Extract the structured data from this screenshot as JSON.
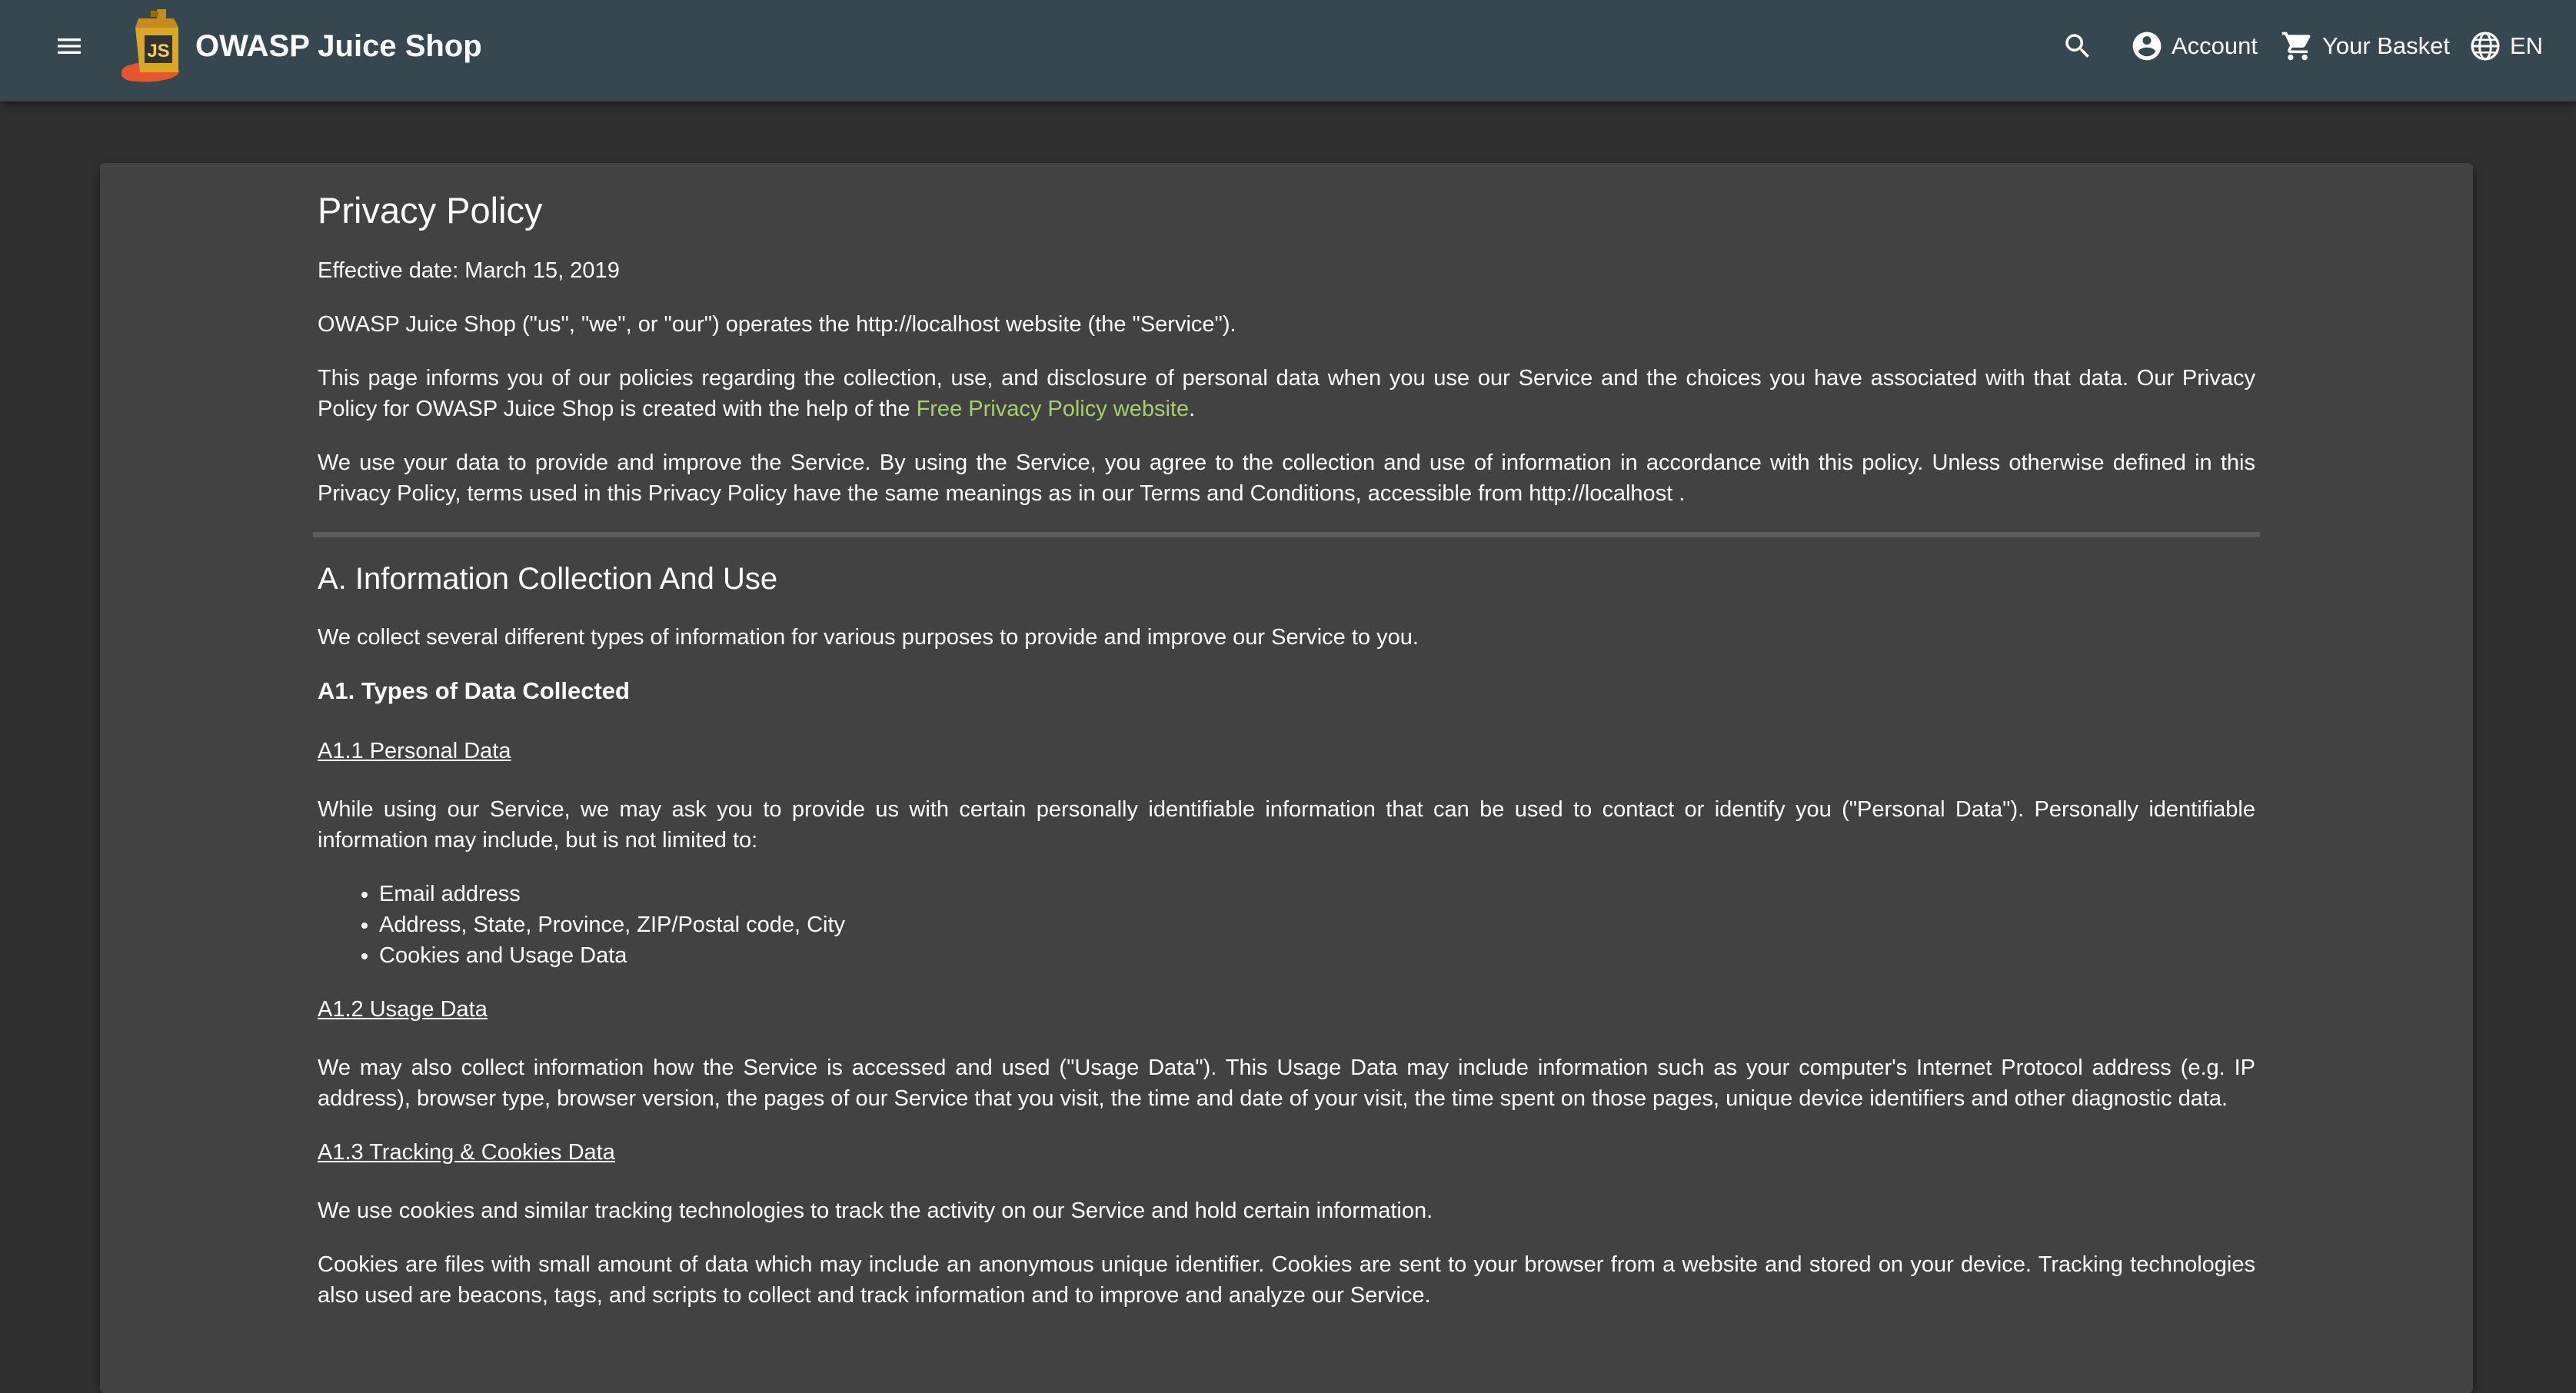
{
  "header": {
    "app_title": "OWASP Juice Shop",
    "search_icon": "search-icon",
    "account_label": "Account",
    "basket_label": "Your Basket",
    "language_label": "EN",
    "colors": {
      "toolbar": "#37474f",
      "background": "#303030",
      "card": "#424242",
      "link": "#a6d06b"
    }
  },
  "page": {
    "title": "Privacy Policy",
    "effective_date": "Effective date: March 15, 2019",
    "intro_1": "OWASP Juice Shop (\"us\", \"we\", or \"our\") operates the http://localhost website (the \"Service\").",
    "intro_2_before": "This page informs you of our policies regarding the collection, use, and disclosure of personal data when you use our Service and the choices you have associated with that data. Our Privacy Policy for OWASP Juice Shop is created with the help of the ",
    "intro_2_link": "Free Privacy Policy website",
    "intro_2_after": ".",
    "intro_3": "We use your data to provide and improve the Service. By using the Service, you agree to the collection and use of information in accordance with this policy. Unless otherwise defined in this Privacy Policy, terms used in this Privacy Policy have the same meanings as in our Terms and Conditions, accessible from http://localhost ."
  },
  "section_a": {
    "title": "A. Information Collection And Use",
    "intro": "We collect several different types of information for various purposes to provide and improve our Service to you.",
    "a1_title": "A1. Types of Data Collected",
    "a11_title": "A1.1 Personal Data",
    "a11_text": "While using our Service, we may ask you to provide us with certain personally identifiable information that can be used to contact or identify you (\"Personal Data\"). Personally identifiable information may include, but is not limited to:",
    "a11_items": [
      "Email address",
      "Address, State, Province, ZIP/Postal code, City",
      "Cookies and Usage Data"
    ],
    "a12_title": "A1.2 Usage Data",
    "a12_text": "We may also collect information how the Service is accessed and used (\"Usage Data\"). This Usage Data may include information such as your computer's Internet Protocol address (e.g. IP address), browser type, browser version, the pages of our Service that you visit, the time and date of your visit, the time spent on those pages, unique device identifiers and other diagnostic data.",
    "a13_title": "A1.3 Tracking & Cookies Data",
    "a13_text_1": "We use cookies and similar tracking technologies to track the activity on our Service and hold certain information.",
    "a13_text_2": "Cookies are files with small amount of data which may include an anonymous unique identifier. Cookies are sent to your browser from a website and stored on your device. Tracking technologies also used are beacons, tags, and scripts to collect and track information and to improve and analyze our Service."
  }
}
